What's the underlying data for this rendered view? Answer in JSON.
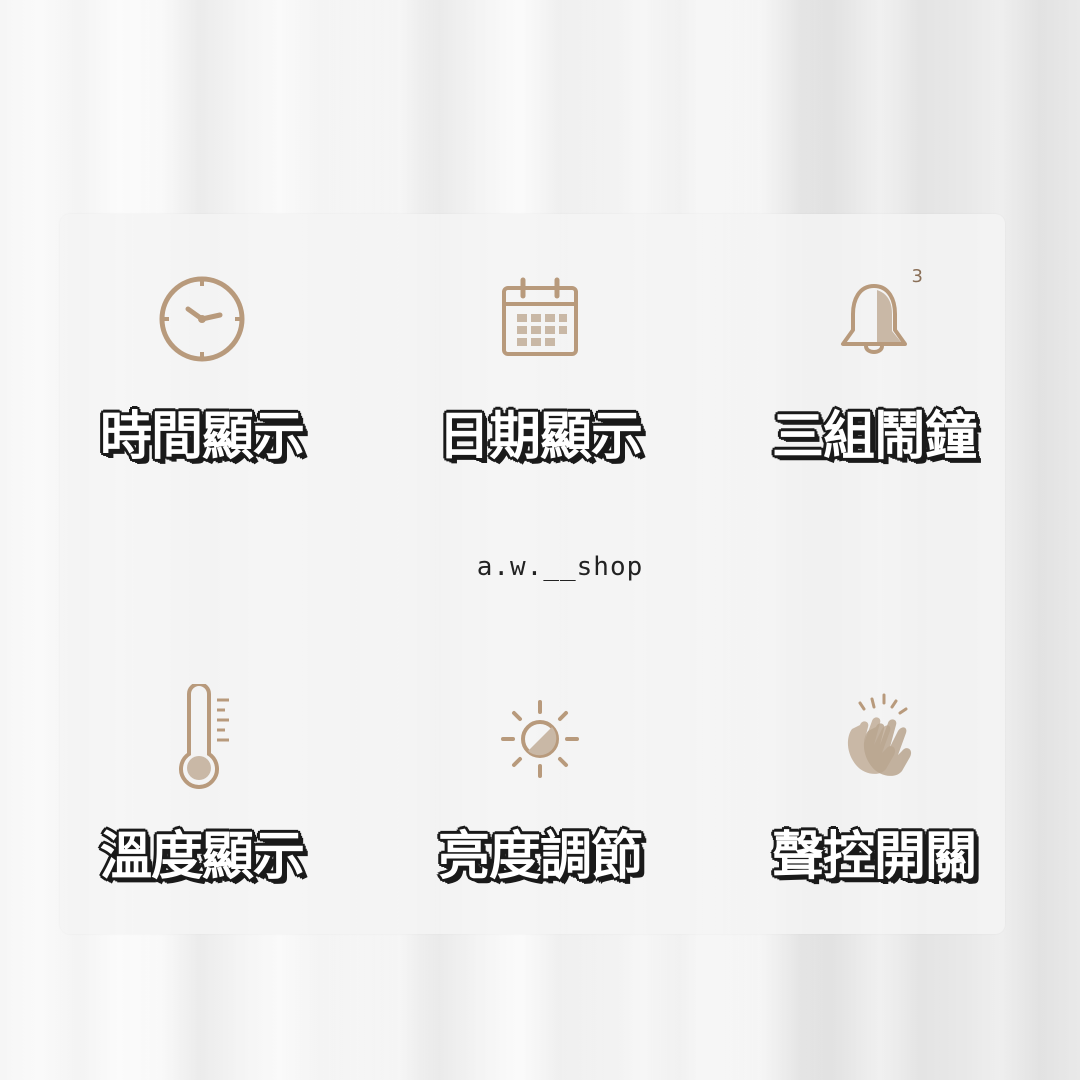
{
  "features": [
    {
      "label": "時間顯示",
      "icon": "clock-icon"
    },
    {
      "label": "日期顯示",
      "icon": "calendar-icon"
    },
    {
      "label": "三組鬧鐘",
      "icon": "bell-icon",
      "badge": "3"
    },
    {
      "label": "溫度顯示",
      "icon": "thermometer-icon"
    },
    {
      "label": "亮度調節",
      "icon": "brightness-icon"
    },
    {
      "label": "聲控開關",
      "icon": "clapping-hands-icon"
    }
  ],
  "shop": {
    "name": "a.w.__shop"
  },
  "colors": {
    "icon": "#b89a7c",
    "icon_fill": "#c9b8a6",
    "label_outline": "#1a1a1a"
  }
}
